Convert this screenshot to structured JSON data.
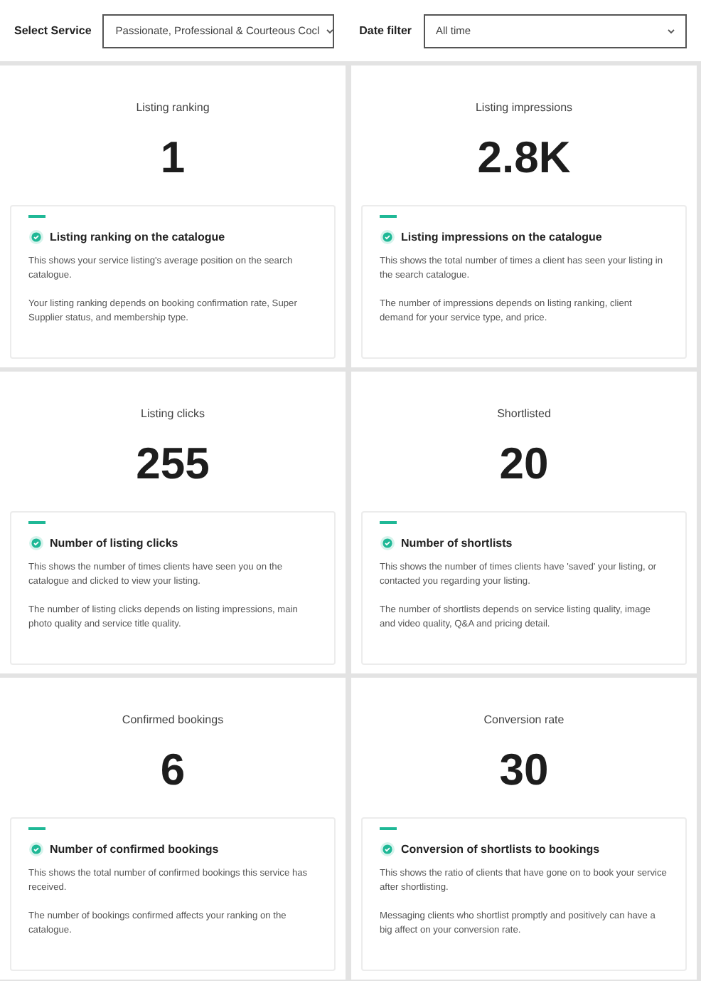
{
  "filters": [
    {
      "label": "Select Service",
      "value": "Passionate, Professional & Courteous Cocl"
    },
    {
      "label": "Date filter",
      "value": "All time"
    }
  ],
  "metrics": [
    {
      "title": "Listing ranking",
      "value": "1",
      "heading": "Listing ranking on the catalogue",
      "paragraphs": [
        "This shows your service listing's average position on the search catalogue.",
        "Your listing ranking depends on booking confirmation rate, Super Supplier status, and membership type."
      ]
    },
    {
      "title": "Listing impressions",
      "value": "2.8K",
      "heading": "Listing impressions on the catalogue",
      "paragraphs": [
        "This shows the total number of times a client has seen your listing in the search catalogue.",
        "The number of impressions depends on listing ranking, client demand for your service type, and price."
      ]
    },
    {
      "title": "Listing clicks",
      "value": "255",
      "heading": "Number of listing clicks",
      "paragraphs": [
        "This shows the number of times clients have seen you on the catalogue and clicked to view your listing.",
        "The number of listing clicks depends on listing impressions, main photo quality and service title quality."
      ]
    },
    {
      "title": "Shortlisted",
      "value": "20",
      "heading": "Number of shortlists",
      "paragraphs": [
        "This shows the number of times clients have 'saved' your listing, or contacted you regarding your listing.",
        "The number of shortlists depends on service listing quality, image and video quality, Q&A and pricing detail."
      ]
    },
    {
      "title": "Confirmed bookings",
      "value": "6",
      "heading": "Number of confirmed bookings",
      "paragraphs": [
        "This shows the total number of confirmed bookings this service has received.",
        "The number of bookings confirmed affects your ranking on the catalogue."
      ]
    },
    {
      "title": "Conversion rate",
      "value": "30",
      "heading": "Conversion of shortlists to bookings",
      "paragraphs": [
        "This shows the ratio of clients that have gone on to book your service after shortlisting.",
        "Messaging clients who shortlist promptly and positively can have a big affect on your conversion rate."
      ]
    }
  ]
}
